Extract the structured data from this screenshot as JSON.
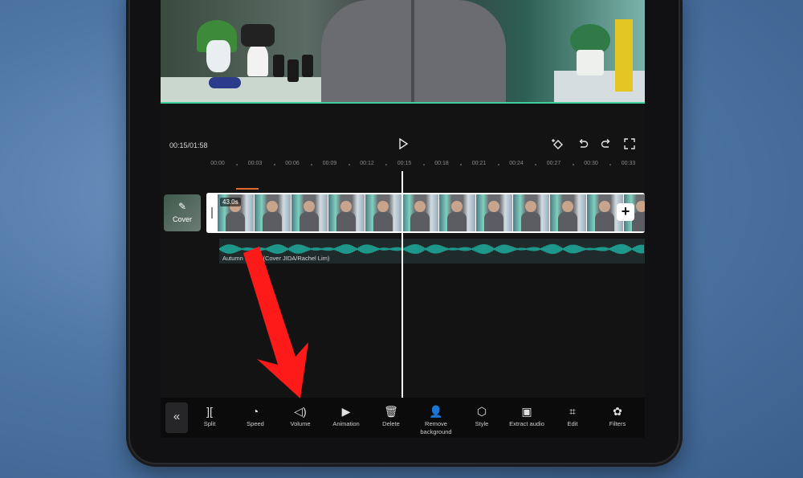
{
  "player": {
    "time": "00:15/01:58",
    "play_icon": "play-icon",
    "keyframe_icon": "keyframe-icon",
    "undo_icon": "undo-icon",
    "redo_icon": "redo-icon",
    "fullscreen_icon": "fullscreen-icon"
  },
  "ruler": {
    "ticks": [
      "00:00",
      "00:03",
      "00:06",
      "00:09",
      "00:12",
      "00:15",
      "00:18",
      "00:21",
      "00:24",
      "00:27",
      "00:30",
      "00:33"
    ]
  },
  "cover": {
    "label": "Cover"
  },
  "video_track": {
    "duration": "43.0s"
  },
  "audio_track": {
    "name": "Autumn Leave (Cover JIDA/Rachel Lim)"
  },
  "toolbar": {
    "back_icon": "double-chevron-left-icon",
    "tools": [
      {
        "label": "Split",
        "icon": "split-icon"
      },
      {
        "label": "Speed",
        "icon": "speed-icon"
      },
      {
        "label": "Volume",
        "icon": "volume-icon"
      },
      {
        "label": "Animation",
        "icon": "animation-icon"
      },
      {
        "label": "Delete",
        "icon": "trash-icon"
      },
      {
        "label": "Remove background",
        "icon": "remove-background-icon"
      },
      {
        "label": "Style",
        "icon": "style-icon"
      },
      {
        "label": "Extract audio",
        "icon": "extract-audio-icon"
      },
      {
        "label": "Edit",
        "icon": "crop-icon"
      },
      {
        "label": "Filters",
        "icon": "filters-icon"
      }
    ]
  },
  "colors": {
    "annotation_arrow": "#ff1a1a",
    "waveform": "#1fc7b4",
    "accent_timeline": "#e26b2f"
  }
}
